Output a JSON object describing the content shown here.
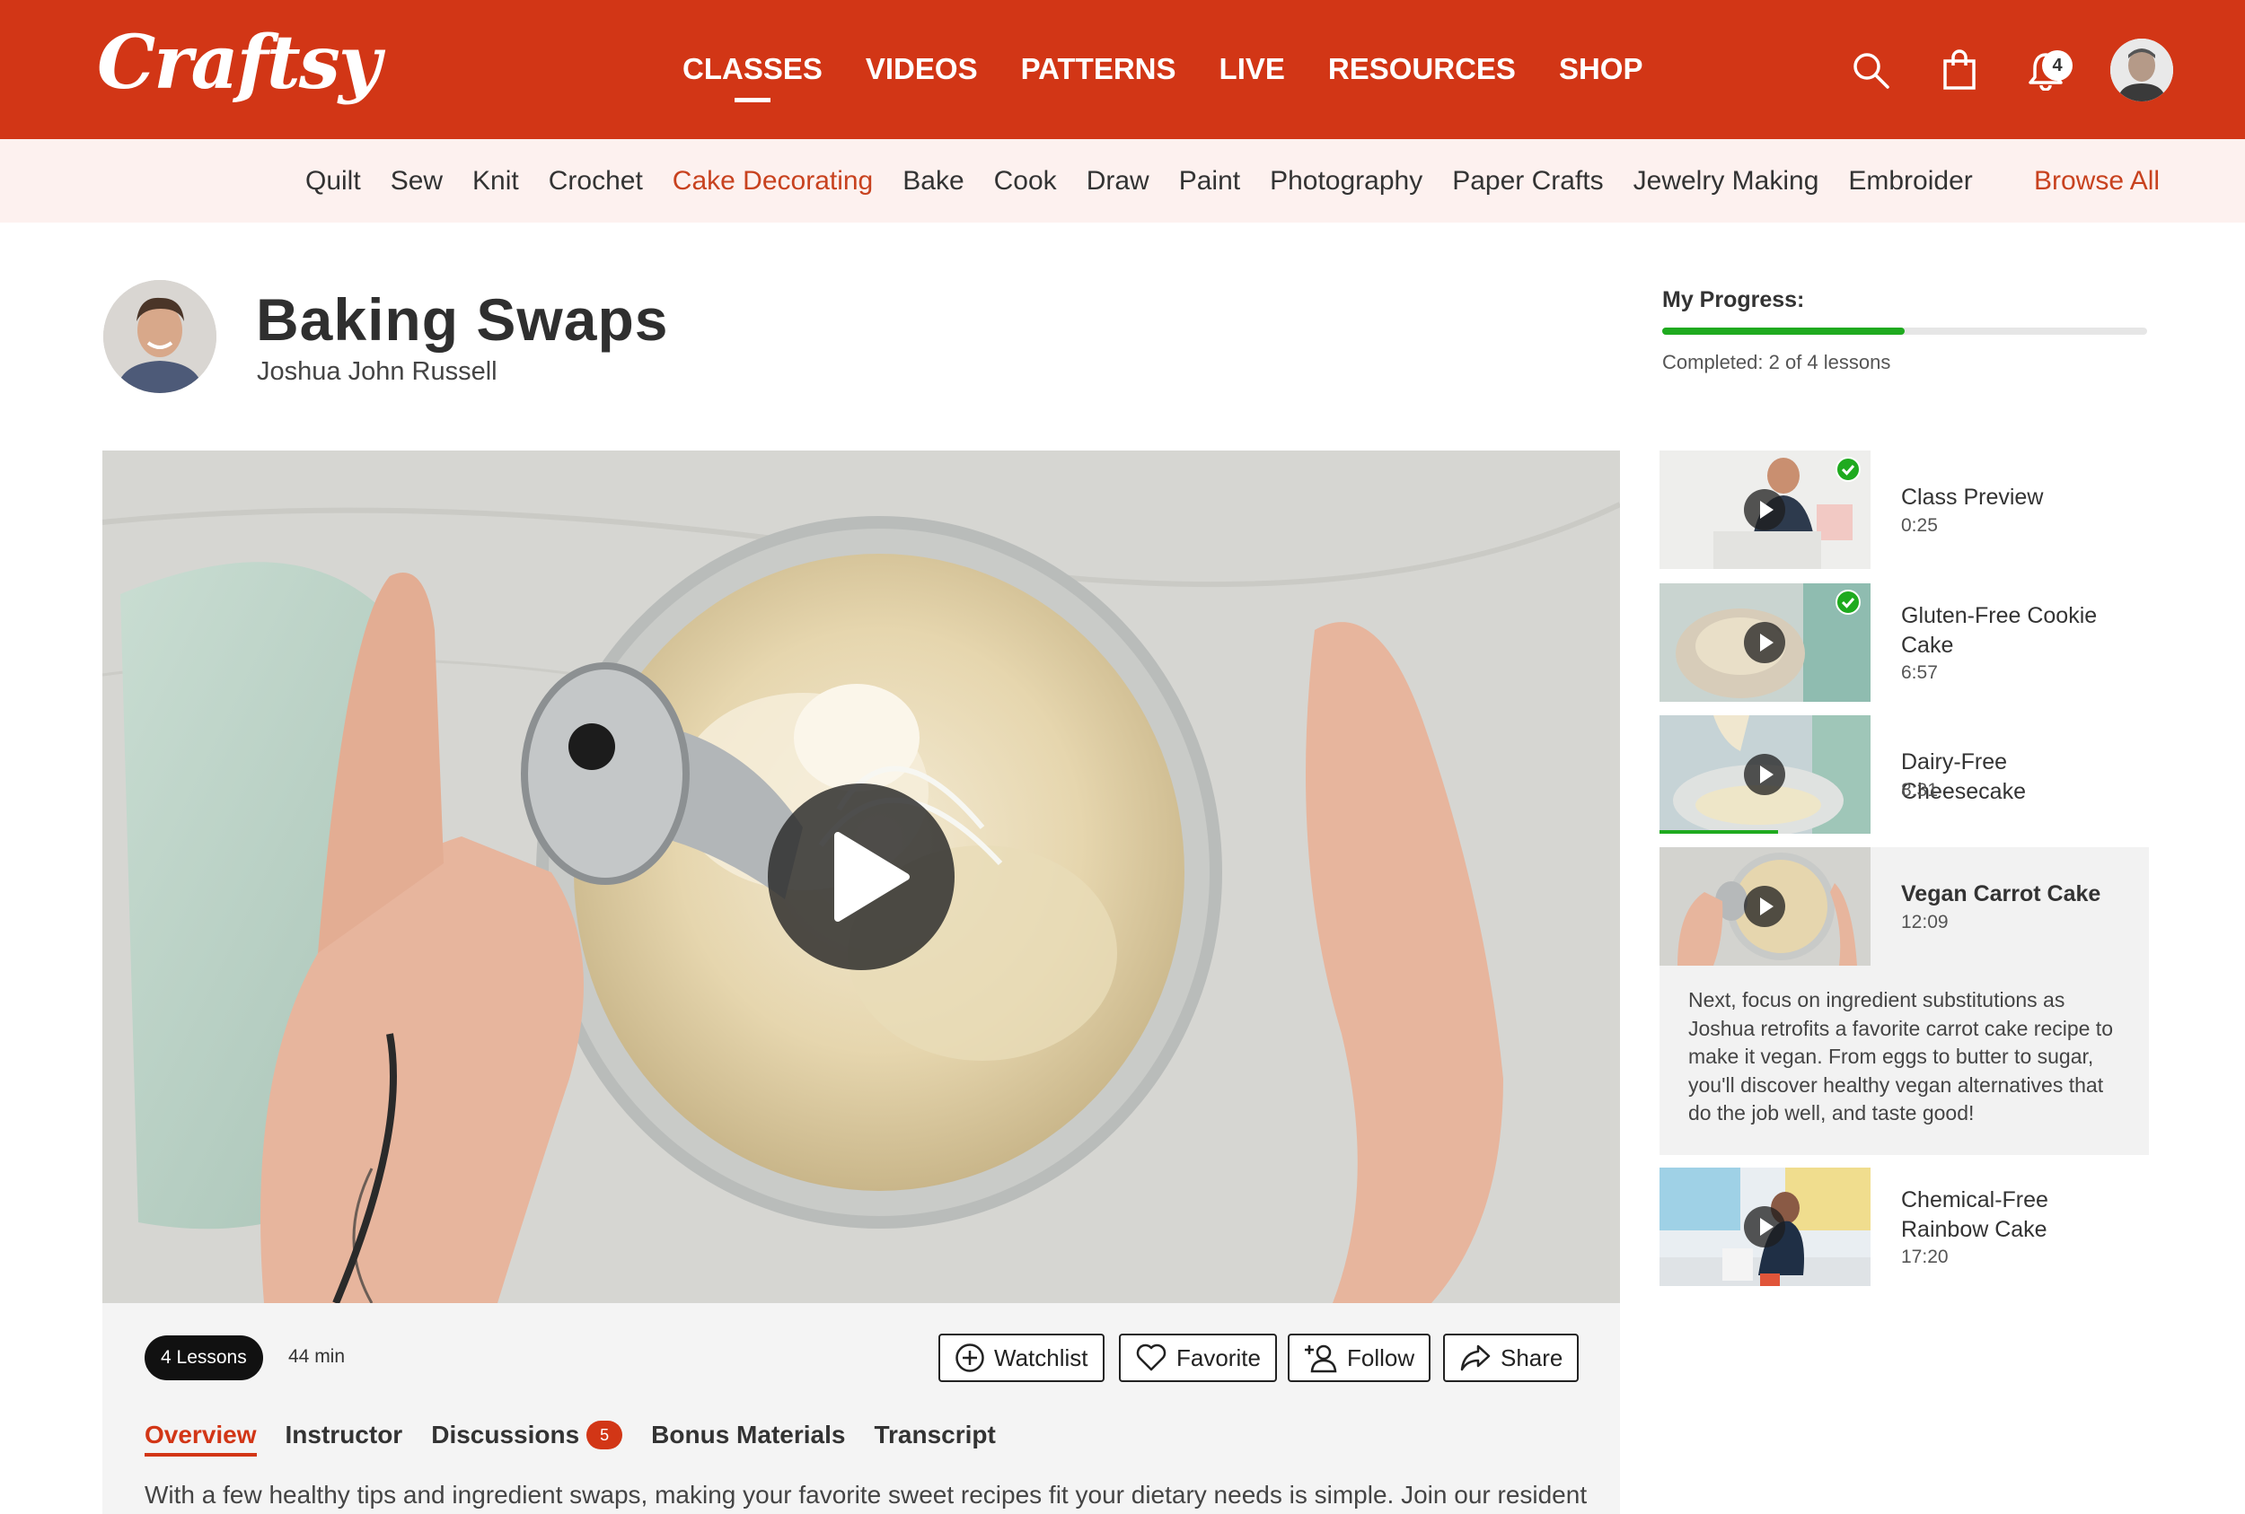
{
  "brand": {
    "logo": "Craftsy",
    "color": "#d23616"
  },
  "nav": {
    "items": [
      "CLASSES",
      "VIDEOS",
      "PATTERNS",
      "LIVE",
      "RESOURCES",
      "SHOP"
    ],
    "active": "CLASSES"
  },
  "header_icons": {
    "search": "search-icon",
    "cart": "shopping-bag-icon",
    "notifications": "bell-icon",
    "notification_count": "4"
  },
  "categories": {
    "items": [
      "Quilt",
      "Sew",
      "Knit",
      "Crochet",
      "Cake Decorating",
      "Bake",
      "Cook",
      "Draw",
      "Paint",
      "Photography",
      "Paper Crafts",
      "Jewelry Making",
      "Embroider"
    ],
    "active": "Cake Decorating",
    "browse_all": "Browse All"
  },
  "class": {
    "title": "Baking Swaps",
    "instructor": "Joshua John Russell"
  },
  "progress": {
    "label": "My Progress:",
    "completed_text": "Completed: 2 of 4 lessons",
    "fraction": 0.5,
    "color": "#1faa1f"
  },
  "meta": {
    "lessons": "4 Lessons",
    "duration": "44 min"
  },
  "actions": {
    "watchlist": "Watchlist",
    "favorite": "Favorite",
    "follow": "Follow",
    "share": "Share"
  },
  "tabs": {
    "overview": "Overview",
    "instructor": "Instructor",
    "discussions": "Discussions",
    "discussions_count": "5",
    "bonus": "Bonus Materials",
    "transcript": "Transcript"
  },
  "overview_text": "With a few healthy tips and ingredient swaps, making your favorite sweet recipes fit your dietary needs is simple. Join our resident",
  "lessons": [
    {
      "title": "Class Preview",
      "duration": "0:25",
      "completed": true
    },
    {
      "title": "Gluten-Free Cookie Cake",
      "duration": "6:57",
      "completed": true
    },
    {
      "title": "Dairy-Free Cheesecake",
      "duration": "8:31",
      "completed": false
    },
    {
      "title": "Vegan Carrot Cake",
      "duration": "12:09",
      "completed": false,
      "active": true,
      "description": "Next, focus on ingredient substitutions as Joshua retrofits a favorite carrot cake recipe to make it vegan. From eggs to butter to sugar, you'll discover healthy vegan alternatives that do the job well, and taste good!"
    },
    {
      "title": "Chemical-Free Rainbow Cake",
      "duration": "17:20",
      "completed": false
    }
  ]
}
